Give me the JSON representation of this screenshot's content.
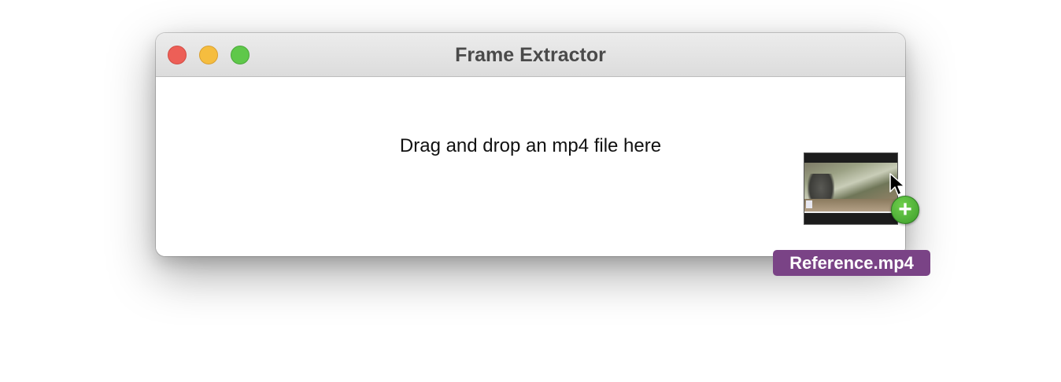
{
  "window": {
    "title": "Frame Extractor",
    "buttons": {
      "close": "close-icon",
      "minimize": "minimize-icon",
      "zoom": "zoom-icon"
    }
  },
  "content": {
    "drop_prompt": "Drag and drop an mp4 file here"
  },
  "drag_item": {
    "file_name": "Reference.mp4",
    "badge_symbol": "+",
    "badge_icon": "plus-icon",
    "cursor_icon": "arrow-cursor-icon",
    "label_color": "#7a4386",
    "badge_color": "#4cb235"
  },
  "colors": {
    "close": "#ed5f57",
    "minimize": "#f5bd3f",
    "zoom": "#5fc84a"
  }
}
